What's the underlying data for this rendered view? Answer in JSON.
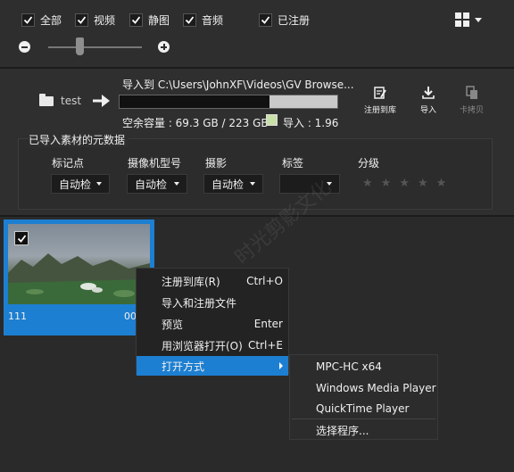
{
  "filters": [
    {
      "label": "全部",
      "checked": true
    },
    {
      "label": "视频",
      "checked": true
    },
    {
      "label": "静图",
      "checked": true
    },
    {
      "label": "音频",
      "checked": true
    },
    {
      "label": "已注册",
      "checked": true
    }
  ],
  "import": {
    "source_name": "test",
    "dest_label": "导入到 C:\\Users\\JohnXF\\Videos\\GV Browse...",
    "free_space": "空余容量 : 69.3 GB / 223 GB",
    "import_size": "导入 : 1.96",
    "used_fraction": 0.31
  },
  "tools": {
    "register": "注册到库",
    "import": "导入",
    "card_copy": "卡拷贝"
  },
  "metadata": {
    "title": "已导入素材的元数据",
    "columns": [
      {
        "label": "标记点",
        "value": "自动检"
      },
      {
        "label": "摄像机型号",
        "value": "自动检"
      },
      {
        "label": "摄影",
        "value": "自动检"
      },
      {
        "label": "标签",
        "value": ""
      },
      {
        "label": "分级",
        "value": ""
      }
    ],
    "rating": 0,
    "max_rating": 5
  },
  "clip": {
    "name": "111",
    "duration": "00",
    "checked": true
  },
  "context_menu": [
    {
      "label": "注册到库(R)",
      "shortcut": "Ctrl+O"
    },
    {
      "label": "导入和注册文件",
      "shortcut": ""
    },
    {
      "label": "预览",
      "shortcut": "Enter"
    },
    {
      "label": "用浏览器打开(O)",
      "shortcut": "Ctrl+E"
    },
    {
      "label": "打开方式",
      "shortcut": ""
    }
  ],
  "open_with_menu": [
    {
      "label": "MPC-HC x64"
    },
    {
      "label": "Windows Media Player"
    },
    {
      "label": "QuickTime Player"
    },
    {
      "label": "选择程序..."
    }
  ],
  "watermark": "时光剪影文化",
  "colors": {
    "accent": "#1d7fd1",
    "background": "#2b2b2b",
    "import_swatch": "#c9e0a8"
  }
}
